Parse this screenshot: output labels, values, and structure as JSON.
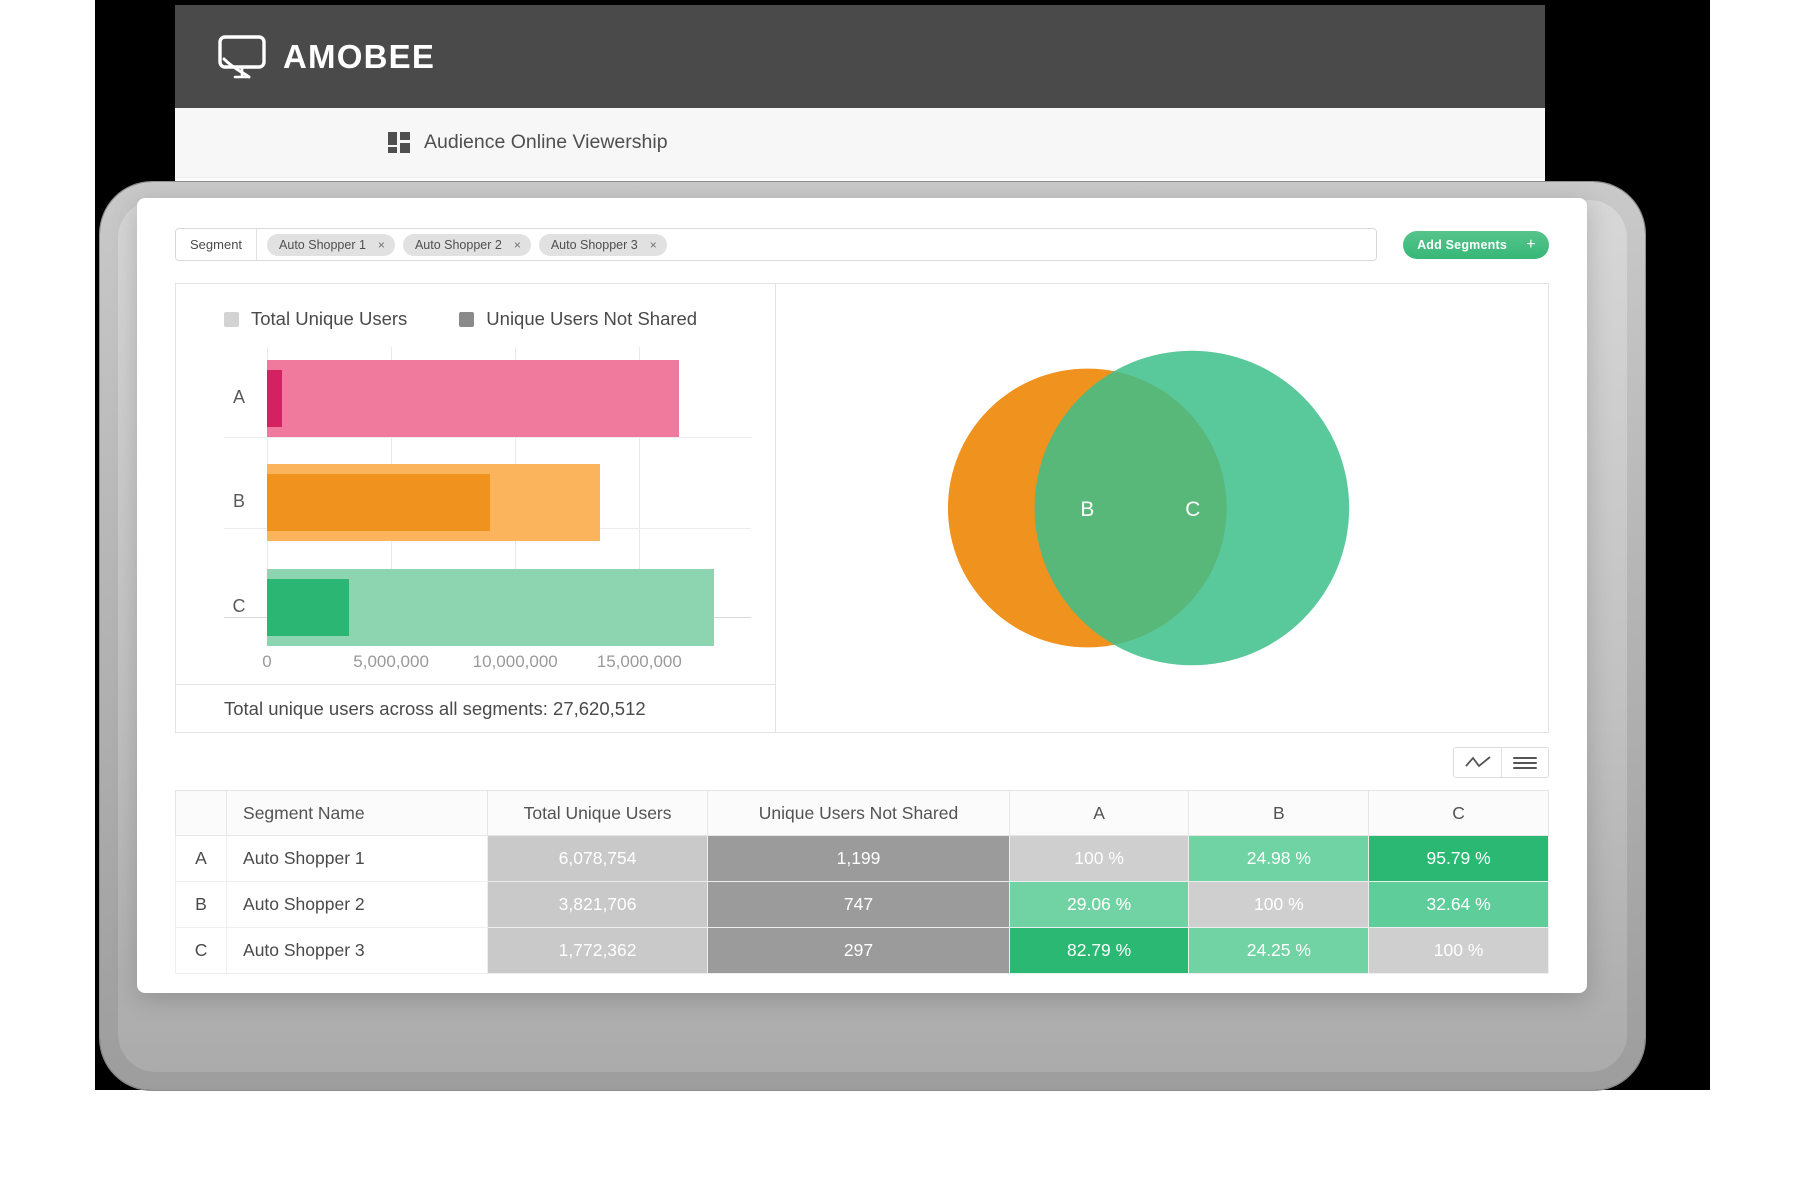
{
  "app": {
    "brand": "AMOBEE",
    "brand_icon": "monitor-icon",
    "breadcrumb": "Audience Online Viewership",
    "breadcrumb_icon": "grid-icon",
    "header_bg": "#4a4a4a"
  },
  "segment_bar": {
    "label": "Segment",
    "chips": [
      {
        "label": "Auto Shopper 1",
        "remove": "×"
      },
      {
        "label": "Auto Shopper 2",
        "remove": "×"
      },
      {
        "label": "Auto Shopper 3",
        "remove": "×"
      }
    ],
    "add_button": {
      "label": "Add Segments",
      "plus": "+",
      "color": "#3cb87b"
    }
  },
  "toolbar": {
    "chart_view_icon": "line-chart-icon",
    "table_view_icon": "list-view-icon"
  },
  "summary": {
    "total_text": "Total unique users across all segments: 27,620,512"
  },
  "chart_data": {
    "type": "bar",
    "title": "",
    "orientation": "horizontal",
    "categories": [
      "A",
      "B",
      "C"
    ],
    "series": [
      {
        "name": "Total Unique Users",
        "values": [
          16600000,
          13400000,
          18000000
        ]
      },
      {
        "name": "Unique Users Not Shared",
        "values": [
          600000,
          9000000,
          3300000
        ]
      }
    ],
    "legend": [
      "Total Unique Users",
      "Unique Users Not Shared"
    ],
    "legend_position": "top-left",
    "legend_swatch_colors": [
      "#d3d3d3",
      "#8a8a8a"
    ],
    "xlabel": "",
    "ylabel": "",
    "xlim": [
      0,
      19500000
    ],
    "xticks": [
      0,
      5000000,
      10000000,
      15000000
    ],
    "xtick_labels": [
      "0",
      "5,000,000",
      "10,000,000",
      "15,000,000"
    ],
    "grid": true,
    "bar_colors": [
      {
        "category": "A",
        "light": "#F07A9D",
        "dark": "#D42162"
      },
      {
        "category": "B",
        "light": "#FBB45C",
        "dark": "#F0921E"
      },
      {
        "category": "C",
        "light": "#8DD4B0",
        "dark": "#2CB673"
      }
    ]
  },
  "venn": {
    "type": "venn",
    "circles": [
      {
        "label": "B",
        "color": "#F0921E",
        "opacity": 1
      },
      {
        "label": "C",
        "color": "#3CBE8A",
        "opacity": 0.85
      }
    ]
  },
  "table": {
    "headers": [
      "",
      "Segment Name",
      "Total Unique Users",
      "Unique Users Not Shared",
      "A",
      "B",
      "C"
    ],
    "rows": [
      {
        "key": "A",
        "name": "Auto Shopper  1",
        "total": "6,078,754",
        "not_shared": "1,199",
        "a": "100 %",
        "b": "24.98  %",
        "c": "95.79 %",
        "a_bg": "#cfcfcf",
        "b_bg": "#70d3a3",
        "c_bg": "#2bb873"
      },
      {
        "key": "B",
        "name": "Auto Shopper 2",
        "total": "3,821,706",
        "not_shared": "747",
        "a": "29.06 %",
        "b": "100 %",
        "c": "32.64 %",
        "a_bg": "#71d3a4",
        "b_bg": "#cfcfcf",
        "c_bg": "#5fcd9a"
      },
      {
        "key": "C",
        "name": "Auto Shopper 3",
        "total": "1,772,362",
        "not_shared": "297",
        "a": "82.79 %",
        "b": "24.25 %",
        "c": "100 %",
        "a_bg": "#2bb873",
        "b_bg": "#71d3a4",
        "c_bg": "#cfcfcf"
      }
    ],
    "total_col_bg": "#c9c9c9",
    "not_shared_col_bg": "#9b9b9b"
  }
}
